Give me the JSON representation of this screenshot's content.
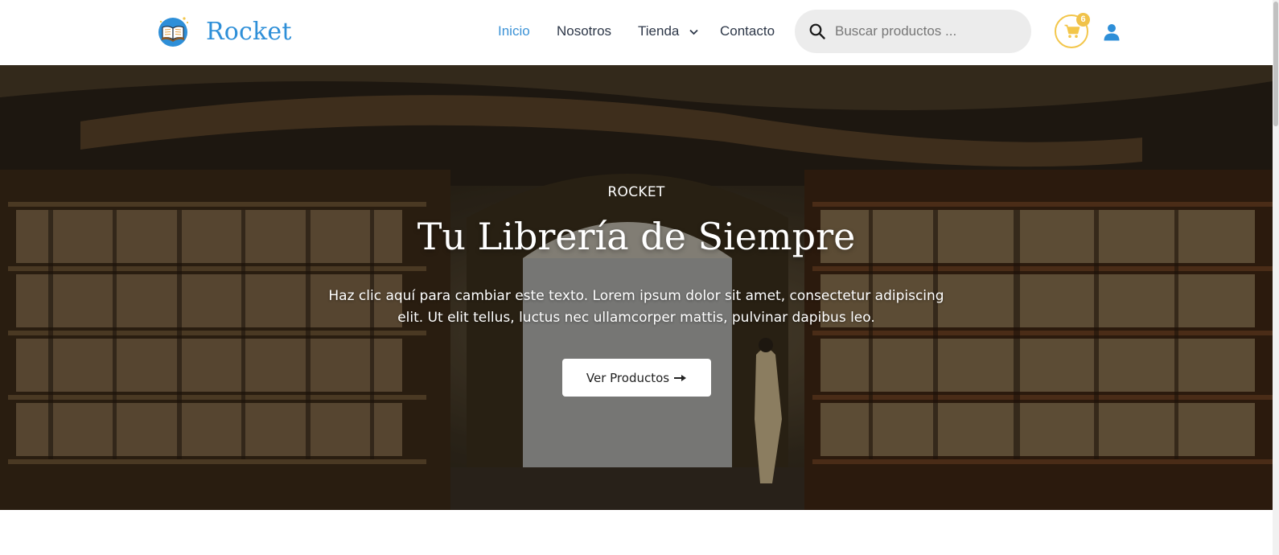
{
  "brand": {
    "name": "Rocket",
    "logo_icon": "open-book-icon",
    "accent": "#2e8fd8"
  },
  "nav": {
    "items": [
      {
        "label": "Inicio",
        "active": true
      },
      {
        "label": "Nosotros",
        "active": false
      },
      {
        "label": "Tienda",
        "active": false,
        "has_dropdown": true
      },
      {
        "label": "Contacto",
        "active": false
      }
    ]
  },
  "search": {
    "placeholder": "Buscar productos ...",
    "icon": "search-icon"
  },
  "cart": {
    "count": "6",
    "icon": "cart-icon",
    "color": "#f3c64a"
  },
  "account": {
    "icon": "user-icon"
  },
  "hero": {
    "eyebrow": "ROCKET",
    "title": "Tu Librería de Siempre",
    "text": "Haz clic aquí para cambiar este texto. Lorem ipsum dolor sit amet, consectetur adipiscing elit. Ut elit tellus, luctus nec ullamcorper mattis, pulvinar dapibus leo.",
    "button_label": "Ver Productos",
    "button_icon": "arrow-right-icon",
    "background": "bookstore-interior-photo"
  }
}
